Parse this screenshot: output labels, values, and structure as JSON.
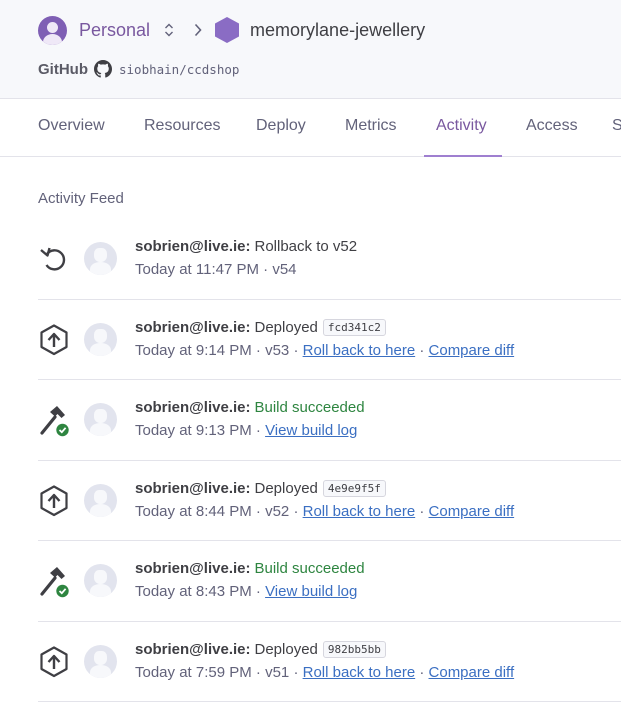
{
  "header": {
    "team": "Personal",
    "app_name": "memorylane-jewellery",
    "github_label": "GitHub",
    "repo": "siobhain/ccdshop"
  },
  "tabs": [
    {
      "label": "Overview"
    },
    {
      "label": "Resources"
    },
    {
      "label": "Deploy"
    },
    {
      "label": "Metrics"
    },
    {
      "label": "Activity",
      "active": true
    },
    {
      "label": "Access"
    },
    {
      "label": "S"
    }
  ],
  "feed": {
    "title": "Activity Feed",
    "items": [
      {
        "type": "rollback",
        "user": "sobrien@live.ie:",
        "action": "Rollback to v52",
        "time": "Today at 11:47 PM",
        "version": "v54"
      },
      {
        "type": "deploy",
        "user": "sobrien@live.ie:",
        "action": "Deployed",
        "sha": "fcd341c2",
        "time": "Today at 9:14 PM",
        "version": "v53",
        "rollback": "Roll back to here",
        "diff": "Compare diff"
      },
      {
        "type": "build",
        "user": "sobrien@live.ie:",
        "action": "Build succeeded",
        "time": "Today at 9:13 PM",
        "log": "View build log"
      },
      {
        "type": "deploy",
        "user": "sobrien@live.ie:",
        "action": "Deployed",
        "sha": "4e9e9f5f",
        "time": "Today at 8:44 PM",
        "version": "v52",
        "rollback": "Roll back to here",
        "diff": "Compare diff"
      },
      {
        "type": "build",
        "user": "sobrien@live.ie:",
        "action": "Build succeeded",
        "time": "Today at 8:43 PM",
        "log": "View build log"
      },
      {
        "type": "deploy",
        "user": "sobrien@live.ie:",
        "action": "Deployed",
        "sha": "982bb5bb",
        "time": "Today at 7:59 PM",
        "version": "v51",
        "rollback": "Roll back to here",
        "diff": "Compare diff"
      }
    ]
  },
  "colors": {
    "brand": "#79589f",
    "success": "#2e8540",
    "link": "#3b6fc2"
  }
}
